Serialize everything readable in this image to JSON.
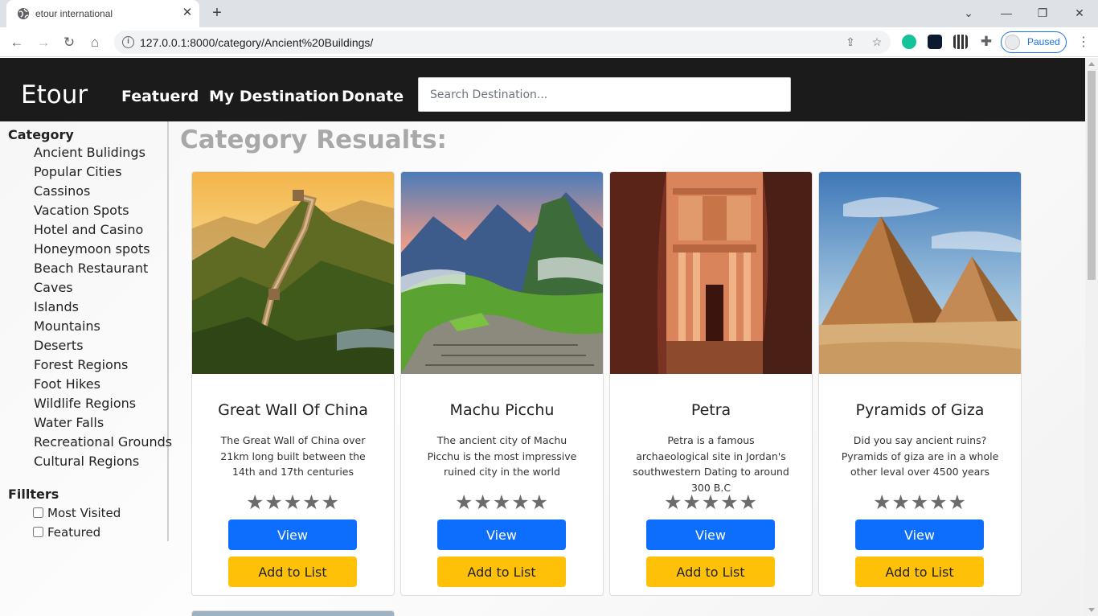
{
  "browser": {
    "tab_title": "etour international",
    "url": "127.0.0.1:8000/category/Ancient%20Buildings/",
    "profile_status": "Paused"
  },
  "site": {
    "brand": "Etour",
    "nav": [
      "Featuerd",
      "My Destination",
      "Donate"
    ],
    "search_placeholder": "Search Destination..."
  },
  "sidebar": {
    "category_heading": "Category",
    "categories": [
      "Ancient Bulidings",
      "Popular Cities",
      "Cassinos",
      "Vacation Spots",
      "Hotel and Casino",
      "Honeymoon spots",
      "Beach Restaurant",
      "Caves",
      "Islands",
      "Mountains",
      "Deserts",
      "Forest Regions",
      "Foot Hikes",
      "Wildlife Regions",
      "Water Falls",
      "Recreational Grounds",
      "Cultural Regions"
    ],
    "filter_heading": "Fillters",
    "filters": [
      "Most Visited",
      "Featured"
    ]
  },
  "main": {
    "title": "Category Resualts:",
    "cards": [
      {
        "title": "Great Wall Of China",
        "desc": "The Great Wall of China over 21km long built between the 14th and 17th centuries",
        "stars": "★★★★★",
        "view_label": "View",
        "add_label": "Add to List"
      },
      {
        "title": "Machu Picchu",
        "desc": "The ancient city of Machu Picchu is the most impressive ruined city in the world",
        "stars": "★★★★★",
        "view_label": "View",
        "add_label": "Add to List"
      },
      {
        "title": "Petra",
        "desc": "Petra is a famous archaeological site in Jordan's southwestern Dating to around 300 B.C",
        "stars": "★★★★★",
        "view_label": "View",
        "add_label": "Add to List"
      },
      {
        "title": "Pyramids of Giza",
        "desc": "Did you say ancient ruins? Pyramids of giza are in a whole other leval over 4500 years",
        "stars": "★★★★★",
        "view_label": "View",
        "add_label": "Add to List"
      }
    ]
  },
  "colors": {
    "header_bg": "#1c1b1b",
    "view_button": "#0d6efd",
    "add_button": "#ffc107",
    "title_gray": "#a8a8a8"
  }
}
